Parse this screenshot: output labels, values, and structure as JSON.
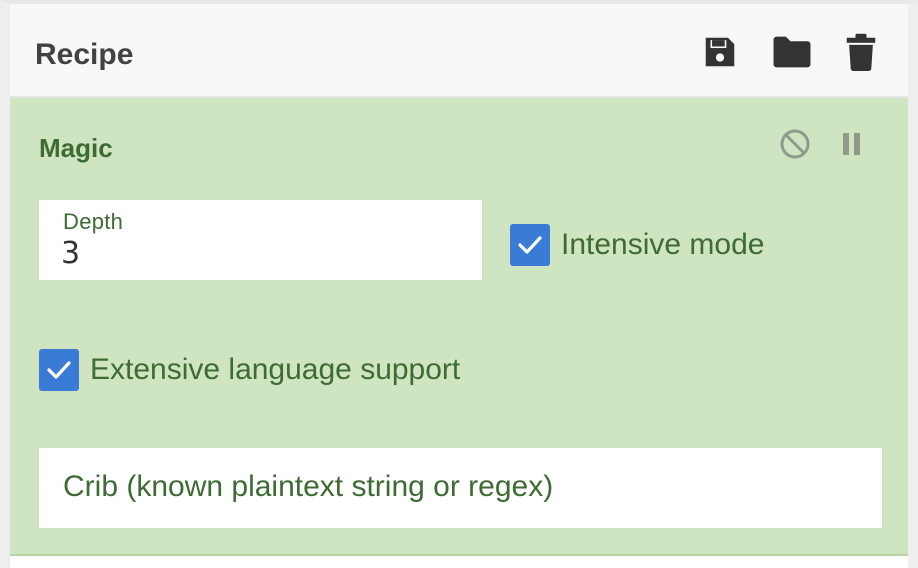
{
  "recipe": {
    "title": "Recipe",
    "actions": {
      "save_icon": "save-icon",
      "load_icon": "folder-icon",
      "clear_icon": "trash-icon"
    }
  },
  "operation": {
    "name": "Magic",
    "controls": {
      "disable_icon": "disable-icon",
      "breakpoint_icon": "pause-icon"
    },
    "depth": {
      "label": "Depth",
      "value": "3"
    },
    "intensive_mode": {
      "label": "Intensive mode",
      "checked": true
    },
    "extensive_language": {
      "label": "Extensive language support",
      "checked": true
    },
    "crib": {
      "placeholder": "Crib (known plaintext string or regex)",
      "value": ""
    }
  },
  "colors": {
    "operation_bg": "#cfe5c2",
    "operation_text": "#3d6b33",
    "checkbox_accent": "#3a7bd5",
    "header_text": "#424242"
  }
}
